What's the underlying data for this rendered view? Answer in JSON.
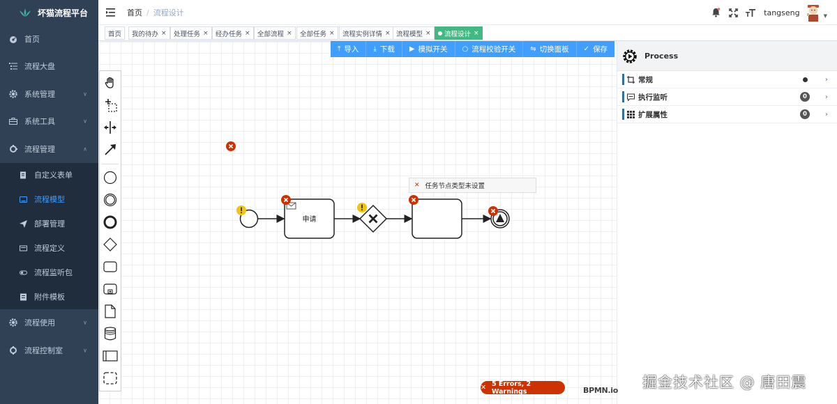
{
  "app": {
    "title": "坏猫流程平台"
  },
  "sidebar": {
    "items": [
      {
        "label": "首页",
        "icon": "dashboard-icon"
      },
      {
        "label": "流程大盘",
        "icon": "list-icon"
      },
      {
        "label": "系统管理",
        "icon": "gear-icon",
        "expandable": true
      },
      {
        "label": "系统工具",
        "icon": "toolbox-icon",
        "expandable": true
      },
      {
        "label": "流程管理",
        "icon": "process-icon",
        "expandable": true,
        "expanded": true
      }
    ],
    "submenu": [
      {
        "label": "自定义表单",
        "icon": "form-icon"
      },
      {
        "label": "流程模型",
        "icon": "model-icon",
        "active": true
      },
      {
        "label": "部署管理",
        "icon": "deploy-icon"
      },
      {
        "label": "流程定义",
        "icon": "definition-icon"
      },
      {
        "label": "流程监听包",
        "icon": "listener-icon"
      },
      {
        "label": "附件模板",
        "icon": "attachment-icon"
      }
    ],
    "after": [
      {
        "label": "流程使用",
        "icon": "gear-icon",
        "expandable": true
      },
      {
        "label": "流程控制室",
        "icon": "control-icon",
        "expandable": true
      }
    ]
  },
  "navbar": {
    "breadcrumb_home": "首页",
    "breadcrumb_separator": "/",
    "breadcrumb_current": "流程设计",
    "username": "tangseng"
  },
  "tags": [
    {
      "label": "首页",
      "closable": false
    },
    {
      "label": "我的待办",
      "closable": true
    },
    {
      "label": "处理任务",
      "closable": true
    },
    {
      "label": "经办任务",
      "closable": true
    },
    {
      "label": "全部流程",
      "closable": true
    },
    {
      "label": "全部任务",
      "closable": true
    },
    {
      "label": "流程实例详情",
      "closable": true
    },
    {
      "label": "流程模型",
      "closable": true
    },
    {
      "label": "流程设计",
      "closable": true,
      "active": true
    }
  ],
  "toolbar": {
    "import": "导入",
    "download": "下载",
    "simulate": "模拟开关",
    "validate": "流程校验开关",
    "switch_panel": "切换面板",
    "save": "保存"
  },
  "diagram": {
    "task1_label": "申请",
    "task2_label": "",
    "error_popup": "任务节点类型未设置"
  },
  "lint": {
    "summary": "5 Errors, 2 Warnings"
  },
  "footer": {
    "bpmn_logo": "BPMN.io",
    "watermark": "掘金技术社区 @ 唐田震"
  },
  "properties": {
    "title": "Process",
    "groups": [
      {
        "label": "常规",
        "marker": "dot"
      },
      {
        "label": "执行监听",
        "count": "0"
      },
      {
        "label": "扩展属性",
        "count": "0"
      }
    ]
  },
  "colors": {
    "sidebar_bg": "#304156",
    "submenu_bg": "#1f2d3d",
    "accent": "#409eff",
    "tag_active": "#42b983",
    "error": "#cc3300",
    "warning": "#ffd700"
  }
}
